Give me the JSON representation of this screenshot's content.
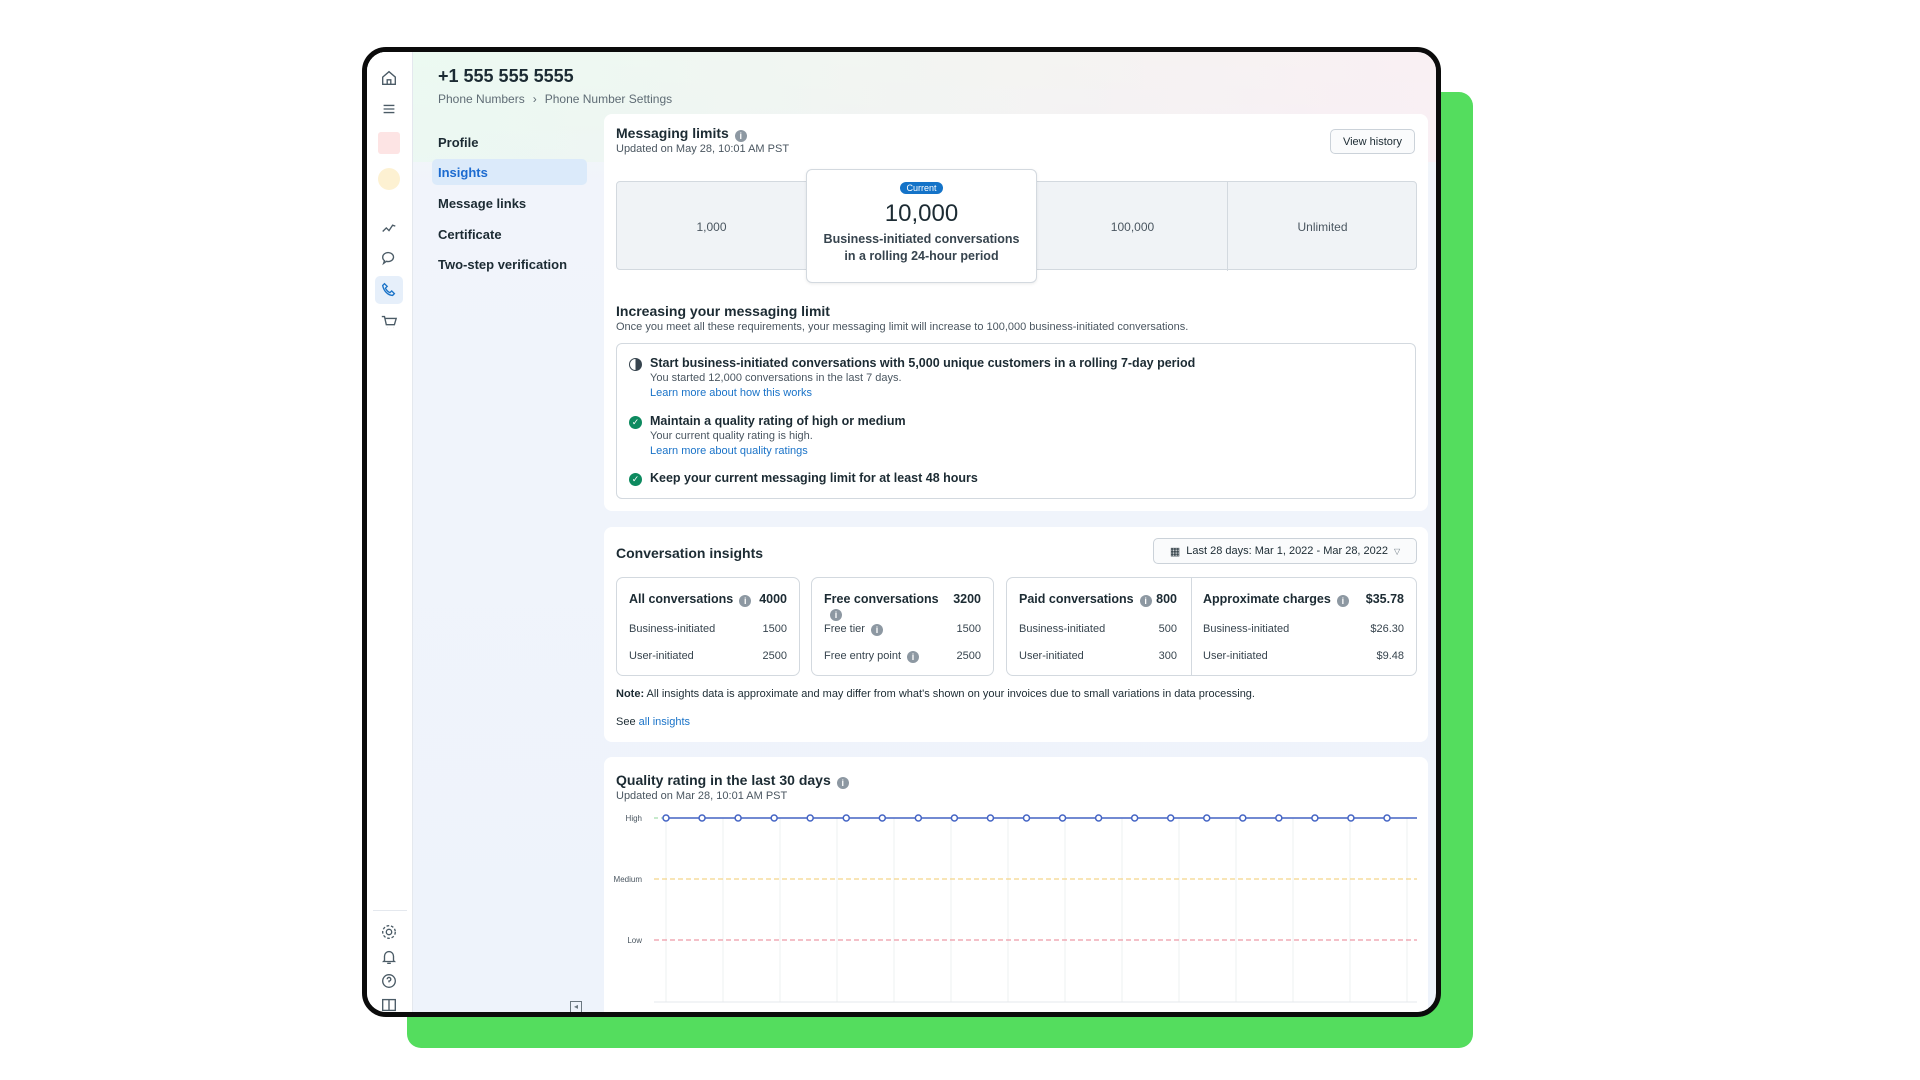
{
  "header": {
    "title": "+1 555 555 5555",
    "breadcrumb": [
      "Phone Numbers",
      "Phone Number Settings"
    ]
  },
  "rail": {
    "top_icons": [
      "home-icon",
      "menu-icon",
      "app-tile-red",
      "app-tile-yellow",
      "analytics-icon",
      "chat-icon",
      "phone-icon",
      "cart-icon"
    ],
    "bottom_icons": [
      "gear-icon",
      "bell-icon",
      "help-icon",
      "panel-icon"
    ],
    "active": "phone-icon"
  },
  "nav": {
    "items": [
      {
        "label": "Profile"
      },
      {
        "label": "Insights",
        "active": true
      },
      {
        "label": "Message links"
      },
      {
        "label": "Certificate"
      },
      {
        "label": "Two-step verification"
      }
    ]
  },
  "limits": {
    "title": "Messaging limits",
    "updated": "Updated on May 28, 10:01 AM PST",
    "view_history": "View history",
    "tiers": [
      "1,000",
      "100,000",
      "Unlimited"
    ],
    "current": {
      "badge": "Current",
      "value": "10,000",
      "desc1": "Business-initiated conversations",
      "desc2": "in a rolling 24-hour period"
    },
    "increase_title": "Increasing your messaging limit",
    "increase_sub": "Once you meet all these requirements, your messaging limit will increase to 100,000 business-initiated conversations.",
    "requirements": [
      {
        "title": "Start business-initiated conversations with 5,000 unique customers in a rolling 7-day period",
        "detail": "You started 12,000 conversations in the last 7 days.",
        "link": "Learn more about how this works",
        "status": "in-progress"
      },
      {
        "title": "Maintain a quality rating of high or medium",
        "detail": "Your current quality rating is high.",
        "link": "Learn more about quality ratings",
        "status": "done"
      },
      {
        "title": "Keep your current messaging limit for at least 48 hours",
        "status": "done"
      }
    ]
  },
  "insights": {
    "title": "Conversation insights",
    "date_range": "Last 28 days: Mar 1, 2022 - Mar 28, 2022",
    "boxes": [
      {
        "label": "All conversations",
        "total": "4000",
        "rows": [
          [
            "Business-initiated",
            "1500"
          ],
          [
            "User-initiated",
            "2500"
          ]
        ]
      },
      {
        "label": "Free conversations",
        "total": "3200",
        "rows": [
          [
            "Free tier",
            "1500"
          ],
          [
            "Free entry point",
            "2500"
          ]
        ]
      },
      {
        "label": "Paid conversations",
        "total": "800",
        "rows": [
          [
            "Business-initiated",
            "500"
          ],
          [
            "User-initiated",
            "300"
          ]
        ]
      },
      {
        "label": "Approximate charges",
        "total": "$35.78",
        "rows": [
          [
            "Business-initiated",
            "$26.30"
          ],
          [
            "User-initiated",
            "$9.48"
          ]
        ]
      }
    ],
    "note_label": "Note:",
    "note": " All insights data is approximate and may differ from what's shown on your invoices due to small variations in data processing.",
    "see": "See ",
    "see_link": "all insights"
  },
  "quality": {
    "title": "Quality rating in the last 30 days",
    "updated": "Updated on Mar 28, 10:01 AM PST"
  },
  "chart_data": {
    "type": "line",
    "title": "Quality rating in the last 30 days",
    "y_categories": [
      "Low",
      "Medium",
      "High"
    ],
    "values": [
      "High",
      "High",
      "High",
      "High",
      "High",
      "High",
      "High",
      "High",
      "High",
      "High",
      "High",
      "High",
      "High",
      "High",
      "High",
      "High",
      "High",
      "High",
      "High",
      "High",
      "High"
    ],
    "reference_lines": [
      {
        "level": "Medium",
        "color": "#f3d58a",
        "style": "dashed"
      },
      {
        "level": "Low",
        "color": "#ee9aa6",
        "style": "dashed"
      }
    ],
    "series_color": "#4464c4",
    "grid": true
  },
  "colors": {
    "accent": "#1a73c8",
    "frame_bg": "#54dd5e",
    "success": "#0d8a5f"
  }
}
